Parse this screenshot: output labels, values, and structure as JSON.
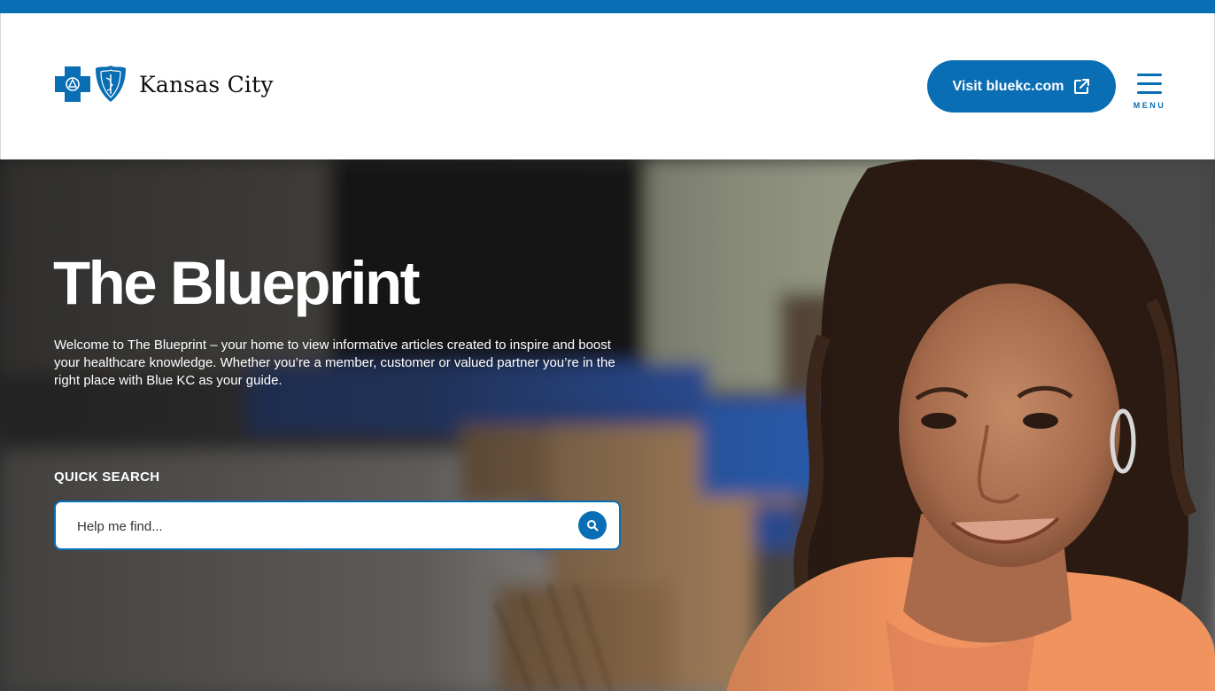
{
  "header": {
    "logo_text": "Kansas City",
    "logo_icon": "blue-cross-blue-shield-logo",
    "visit_button_label": "Visit bluekc.com",
    "visit_button_icon": "external-link-icon",
    "menu_label": "MENU",
    "menu_icon": "hamburger-icon"
  },
  "hero": {
    "title": "The Blueprint",
    "description": "Welcome to The Blueprint – your home to view informative articles created to inspire and boost your healthcare knowledge. Whether you’re a member, customer or valued partner you’re in the right place with Blue KC as your guide.",
    "quick_search_label": "QUICK SEARCH",
    "search_placeholder": "Help me find...",
    "search_value": "",
    "search_icon": "search-icon"
  },
  "colors": {
    "brand_blue": "#0a6eb4",
    "top_bar": "#0a6eb4",
    "white": "#ffffff"
  }
}
